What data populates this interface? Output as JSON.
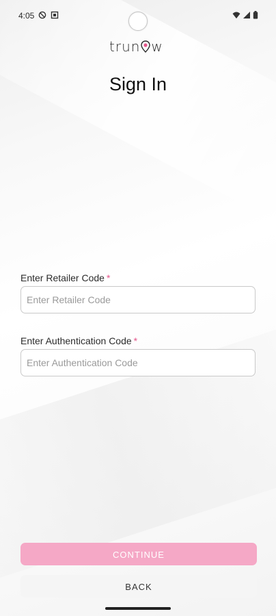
{
  "status_bar": {
    "time": "4:05",
    "left_icons": [
      "do-not-disturb-icon",
      "notification-icon"
    ],
    "right_icons": [
      "wifi-icon",
      "signal-icon",
      "battery-icon"
    ]
  },
  "brand": {
    "logo_text_before": "trun",
    "logo_text_after": "w",
    "accent_color": "#e4558a"
  },
  "page": {
    "title": "Sign In"
  },
  "form": {
    "retailer": {
      "label": "Enter Retailer Code",
      "required_mark": "*",
      "placeholder": "Enter Retailer Code",
      "value": ""
    },
    "auth": {
      "label": "Enter Authentication Code",
      "required_mark": "*",
      "placeholder": "Enter Authentication Code",
      "value": ""
    }
  },
  "actions": {
    "continue_label": "CONTINUE",
    "back_label": "BACK",
    "continue_color": "#f5a8c6"
  }
}
